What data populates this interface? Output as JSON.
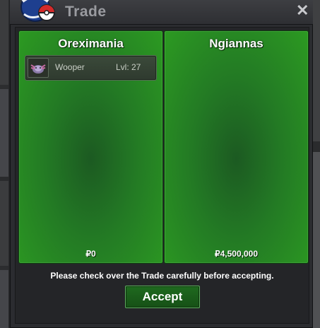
{
  "window": {
    "title": "Trade",
    "close_glyph": "✕"
  },
  "left_panel": {
    "trainer_name": "Oreximania",
    "pokemon": [
      {
        "name": "Wooper",
        "level": "Lvl: 27",
        "icon": "wooper-sprite-icon"
      }
    ],
    "money": "₽0"
  },
  "right_panel": {
    "trainer_name": "Ngiannas",
    "pokemon": [],
    "money": "₽4,500,000"
  },
  "footer": {
    "notice": "Please check over the Trade carefully before accepting.",
    "accept_label": "Accept"
  },
  "colors": {
    "panel_green": "#2c9a22",
    "button_green": "#1f6a1f",
    "window_bg": "#2b2c30"
  }
}
